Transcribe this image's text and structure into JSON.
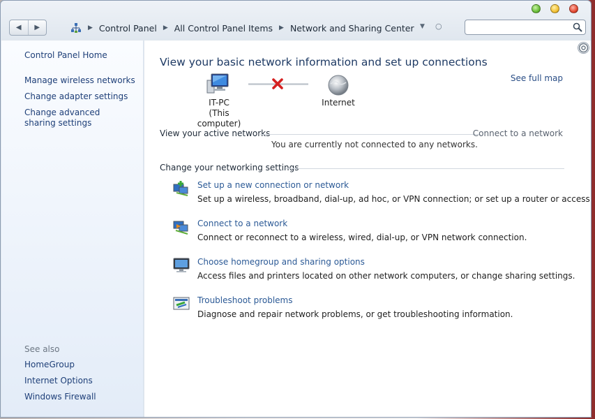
{
  "window": {
    "caption_buttons": [
      "minimize-icon",
      "maximize-icon",
      "close-icon"
    ],
    "colors": {
      "minimize": "#6bbf3a",
      "maximize": "#f2c035",
      "close": "#e34a33"
    }
  },
  "address_bar": {
    "crumbs": [
      "Control Panel",
      "All Control Panel Items",
      "Network and Sharing Center"
    ],
    "search_placeholder": ""
  },
  "sidebar": {
    "home": "Control Panel Home",
    "links": [
      "Manage wireless networks",
      "Change adapter settings",
      "Change advanced sharing settings"
    ],
    "see_also_title": "See also",
    "see_also": [
      "HomeGroup",
      "Internet Options",
      "Windows Firewall"
    ]
  },
  "main": {
    "heading": "View your basic network information and set up connections",
    "see_full_map": "See full map",
    "map": {
      "computer_name": "IT-PC",
      "computer_sub": "(This computer)",
      "internet_label": "Internet",
      "connection_status_icon": "red-x-icon"
    },
    "active_networks": {
      "title": "View your active networks",
      "connect_link": "Connect to a network",
      "status": "You are currently not connected to any networks."
    },
    "settings": {
      "title": "Change your networking settings",
      "tasks": [
        {
          "icon": "new-connection-icon",
          "link": "Set up a new connection or network",
          "desc": "Set up a wireless, broadband, dial-up, ad hoc, or VPN connection; or set up a router or access point."
        },
        {
          "icon": "connect-network-icon",
          "link": "Connect to a network",
          "desc": "Connect or reconnect to a wireless, wired, dial-up, or VPN network connection."
        },
        {
          "icon": "homegroup-icon",
          "link": "Choose homegroup and sharing options",
          "desc": "Access files and printers located on other network computers, or change sharing settings."
        },
        {
          "icon": "troubleshoot-icon",
          "link": "Troubleshoot problems",
          "desc": "Diagnose and repair network problems, or get troubleshooting information."
        }
      ]
    }
  }
}
